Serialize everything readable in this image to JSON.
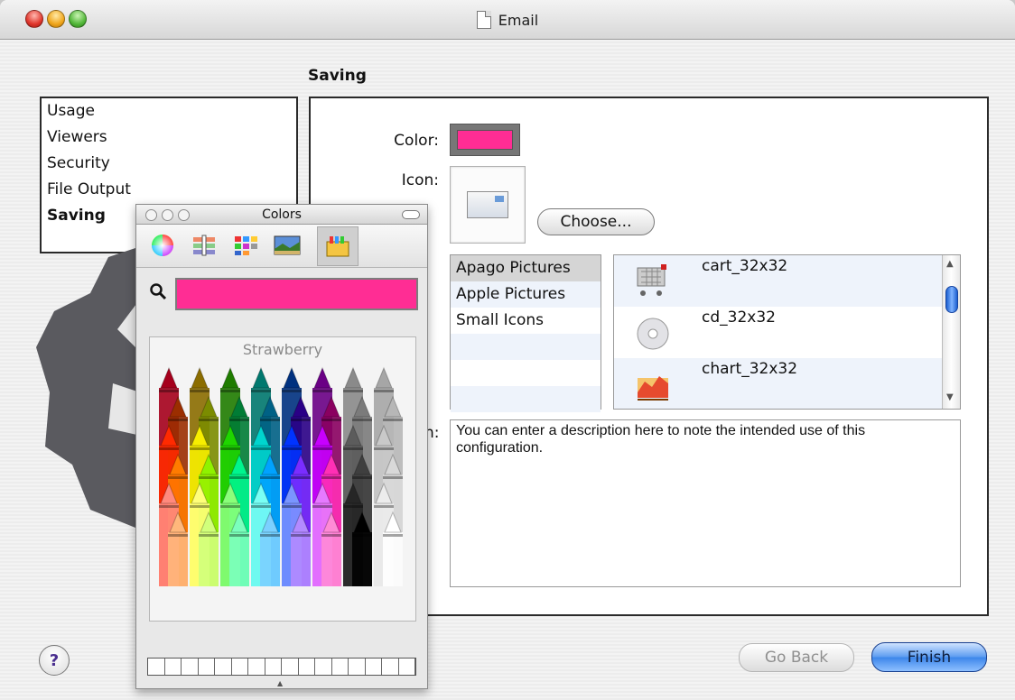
{
  "window": {
    "title": "Email"
  },
  "sidebar": {
    "section_label": "Saving",
    "items": [
      "Usage",
      "Viewers",
      "Security",
      "File Output",
      "Saving"
    ],
    "selected": "Saving"
  },
  "form": {
    "color_label": "Color:",
    "color_value": "#ff2d94",
    "icon_label": "Icon:",
    "choose_label": "Choose...",
    "description_label": "n:",
    "description": "You can enter a description here to note the intended use of this configuration."
  },
  "sources": [
    "Apago Pictures",
    "Apple Pictures",
    "Small Icons"
  ],
  "icons": [
    {
      "name": "cart_32x32",
      "icon": "cart-icon"
    },
    {
      "name": "cd_32x32",
      "icon": "cd-icon"
    },
    {
      "name": "chart_32x32",
      "icon": "chart-icon"
    }
  ],
  "buttons": {
    "help": "?",
    "back": "Go Back",
    "finish": "Finish"
  },
  "colors_panel": {
    "title": "Colors",
    "tabs": [
      "color-wheel-icon",
      "sliders-icon",
      "palettes-icon",
      "image-palette-icon",
      "crayons-icon"
    ],
    "current_color": "#ff2d94",
    "crayon_name": "Strawberry",
    "crayon_colors": [
      [
        "#a5001c",
        "#8b6d00",
        "#1f7c00",
        "#00786e",
        "#00317f",
        "#6a0085",
        "#8a8a8a",
        "#a6a6a6"
      ],
      [
        "#9b2e00",
        "#7b8c00",
        "#007c35",
        "#006185",
        "#2a0086",
        "#8a0060",
        "#7b7b7b",
        "#b7b7b7"
      ],
      [
        "#ff2a00",
        "#f7ee00",
        "#1fd600",
        "#00d5ce",
        "#0033ff",
        "#c800ff",
        "#5c5c5c",
        "#c9c9c9"
      ],
      [
        "#ff7b00",
        "#8ff200",
        "#00f58e",
        "#00a2ff",
        "#7a2dff",
        "#ff2fb5",
        "#3f3f3f",
        "#d9d9d9"
      ],
      [
        "#ff8a7e",
        "#ffff7a",
        "#8aff7a",
        "#7afff4",
        "#7a96ff",
        "#e67aff",
        "#262626",
        "#ececec"
      ],
      [
        "#ffb77b",
        "#d1ff7b",
        "#7bffbd",
        "#7bd0ff",
        "#b38aff",
        "#ff8ad6",
        "#000000",
        "#ffffff"
      ]
    ]
  }
}
